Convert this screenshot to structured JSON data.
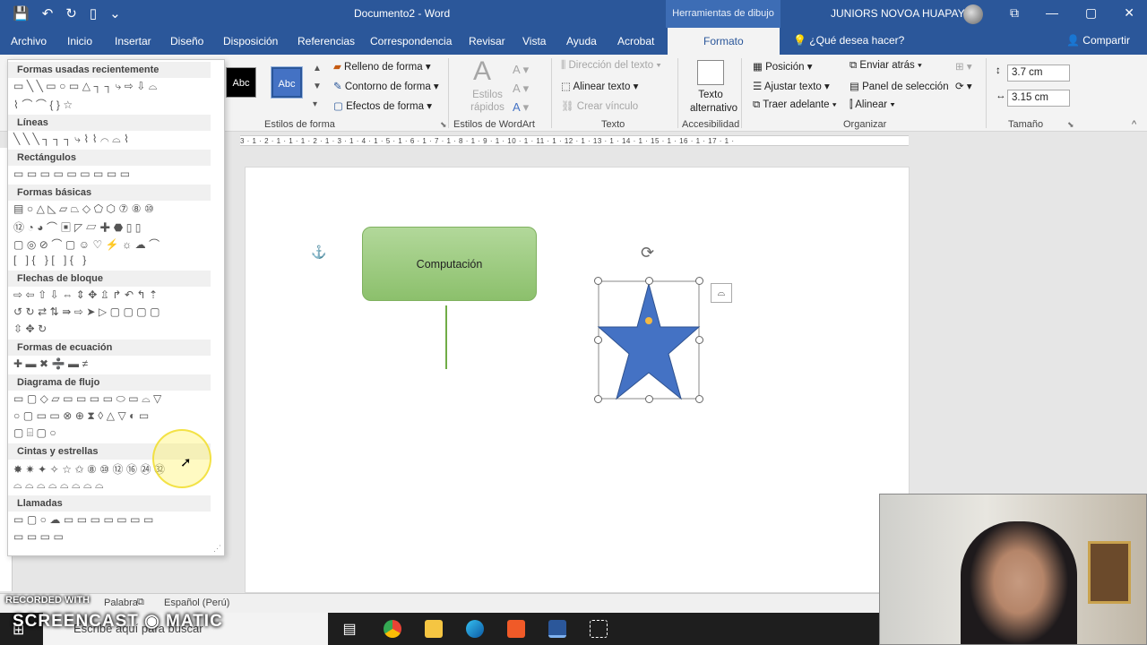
{
  "titlebar": {
    "doc_title": "Documento2  -  Word",
    "context_tab": "Herramientas de dibujo",
    "user_name": "JUNIORS NOVOA HUAPAYA"
  },
  "menu": {
    "tabs": [
      "Archivo",
      "Inicio",
      "Insertar",
      "Diseño",
      "Disposición",
      "Referencias",
      "Correspondencia",
      "Revisar",
      "Vista",
      "Ayuda",
      "Acrobat"
    ],
    "active_tab": "Formato",
    "help": "¿Qué desea hacer?",
    "share": "Compartir"
  },
  "ribbon": {
    "style_boxes": [
      "Abc",
      "Abc"
    ],
    "shape_fill": "Relleno de forma",
    "shape_outline": "Contorno de forma",
    "shape_effects": "Efectos de forma",
    "quick_styles": "Estilos rápidos",
    "text_direction": "Dirección del texto",
    "align_text": "Alinear texto",
    "create_link": "Crear vínculo",
    "alt_text": "Texto alternativo",
    "position": "Posición",
    "wrap_text": "Ajustar texto",
    "bring_forward": "Traer adelante",
    "send_backward": "Enviar atrás",
    "selection_pane": "Panel de selección",
    "align": "Alinear",
    "height": "3.7 cm",
    "width": "3.15 cm",
    "groups": {
      "shape_styles": "Estilos de forma",
      "wordart_styles": "Estilos de WordArt",
      "text": "Texto",
      "accessibility": "Accesibilidad",
      "arrange": "Organizar",
      "size": "Tamaño"
    }
  },
  "ruler_marks": "3 · 1 · 2 · 1 · 1 · 1 · 2 · 1 · 3 · 1 · 4 · 1 · 5 · 1 · 6 · 1 · 7 · 1 · 8 · 1 · 9 · 1 · 10 · 1 · 11 · 1 · 12 · 1 · 13 · 1 · 14 · 1 · 15 · 1 · 16 · 1 · 17 · 1 ·",
  "gallery": {
    "sections": [
      "Formas usadas recientemente",
      "Líneas",
      "Rectángulos",
      "Formas básicas",
      "Flechas de bloque",
      "Formas de ecuación",
      "Diagrama de flujo",
      "Cintas y estrellas",
      "Llamadas"
    ],
    "rows": {
      "recent1": "▭╲╲▭○▭△┐┐⤷⇨⇩⌓",
      "recent2": "⌇⌒⌒{}☆",
      "lines": "╲╲╲┐┐┐⤷⌇⌇⌒⌓⌇",
      "rects": "▭▭▭▭▭▭▭▭▭",
      "basic1": "▤○△◺▱⏢◇⬠⬡⑦⑧⑩",
      "basic2": "⑫◔◕⌒▣◸▱✚⬣▯▯",
      "basic3": "▢◎⊘⌒▢☺♡⚡☼☁⌒",
      "basic4": "[ ]{ }[ ]{ }",
      "arrows1": "⇨⇦⇧⇩⇔⇕✥⇫↱↶↰⇡",
      "arrows2": "↺↻⇄⇅⇛⇨➤▷▢▢▢▢",
      "arrows3": "⇳✥↻",
      "equation": "✚▬✖➗▬≠",
      "flow1": "▭▢◇▱▭▭▭▭⬭▭⌓▽",
      "flow2": "○▢▭▭⊗⊕⧗◊△▽◐▭",
      "flow3": "▢⌸▢○",
      "stars1": "✸✷✦✧☆✩⑧⑩⑫⑯㉔㉜",
      "stars2": "⌓⌓⌓⌓⌓⌓⌓⌓",
      "callouts1": "▭▢○☁▭▭▭▭▭▭▭",
      "callouts2": "▭▭▭▭"
    }
  },
  "document": {
    "rect_text": "Computación"
  },
  "status": {
    "left": "Palabra",
    "language": "Español (Perú)"
  },
  "taskbar": {
    "search": "Escribe aquí para buscar"
  },
  "watermark": {
    "line1": "RECORDED WITH",
    "line2": "SCREENCAST ◉ MATIC"
  },
  "colors": {
    "word_blue": "#2b579a",
    "star_fill": "#4472c4",
    "green_fill": "#a9d18e",
    "green_line": "#70ad47"
  }
}
